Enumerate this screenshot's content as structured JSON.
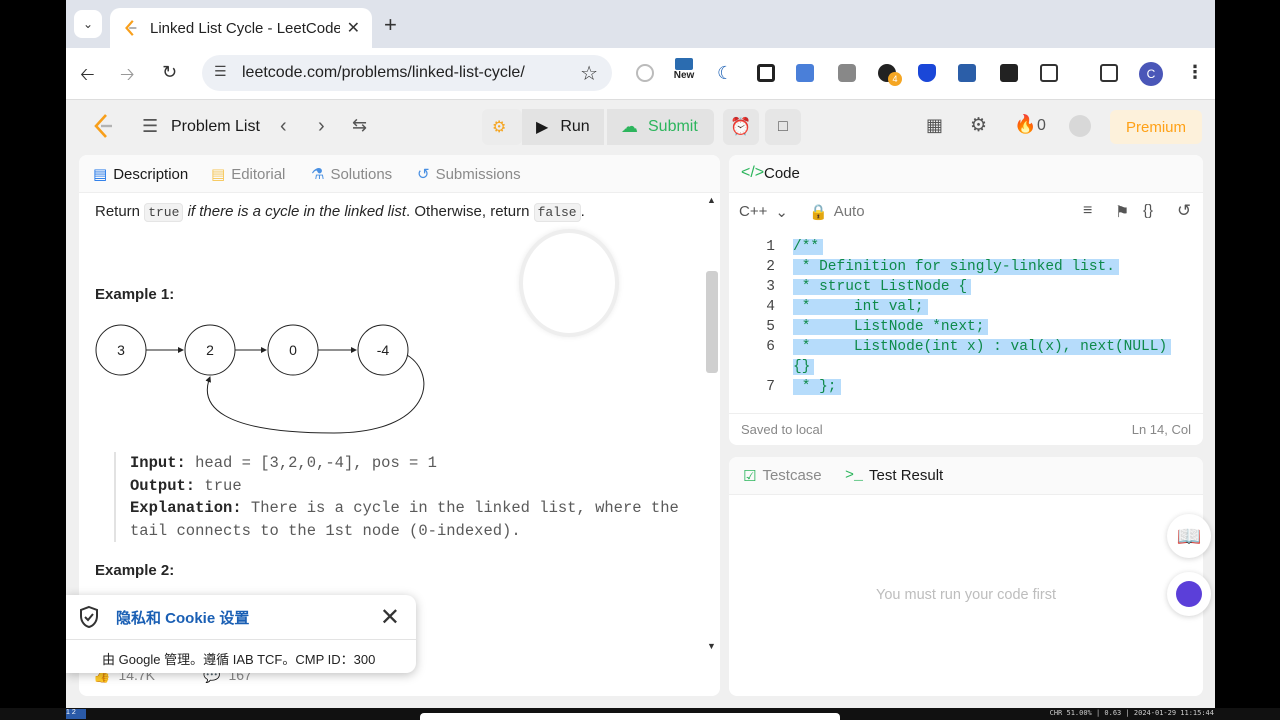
{
  "browser": {
    "tab_title": "Linked List Cycle - LeetCode",
    "url": "leetcode.com/problems/linked-list-cycle/",
    "ext_new_label": "New",
    "ext_badge": "4",
    "profile_initial": "C"
  },
  "nav": {
    "problem_list": "Problem List",
    "run": "Run",
    "submit": "Submit",
    "streak": "0",
    "premium": "Premium"
  },
  "left_tabs": [
    "Description",
    "Editorial",
    "Solutions",
    "Submissions"
  ],
  "description": {
    "return_prefix": "Return ",
    "true_code": "true",
    "italic": " if there is a cycle in the linked list",
    "otherwise": ". Otherwise, return ",
    "false_code": "false",
    "end": ".",
    "example1_title": "Example 1:",
    "example2_title": "Example 2:",
    "nodes": [
      "3",
      "2",
      "0",
      "-4"
    ],
    "input_label": "Input:",
    "input_value": " head = [3,2,0,-4], pos = 1",
    "output_label": "Output:",
    "output_value": " true",
    "explanation_label": "Explanation:",
    "explanation_line1": " There is a cycle in the linked list, where the",
    "explanation_line2": "tail connects to the 1st node (0-indexed).",
    "likes": "14.7K",
    "comments": "167"
  },
  "cookie": {
    "title": "隐私和 Cookie 设置",
    "subtitle": "由 Google 管理。遵循 IAB TCF。CMP ID：300"
  },
  "code": {
    "tab": "Code",
    "language": "C++",
    "mode": "Auto",
    "lines": [
      {
        "n": "1",
        "t": "/**"
      },
      {
        "n": "2",
        "t": " * Definition for singly-linked list."
      },
      {
        "n": "3",
        "t": " * struct ListNode {"
      },
      {
        "n": "4",
        "t": " *     int val;"
      },
      {
        "n": "5",
        "t": " *     ListNode *next;"
      },
      {
        "n": "6",
        "t": " *     ListNode(int x) : val(x), next(NULL)"
      },
      {
        "n": "",
        "t": "{}"
      },
      {
        "n": "7",
        "t": " * };"
      }
    ],
    "saved": "Saved to local",
    "cursor": "Ln 14, Col"
  },
  "test": {
    "testcase_tab": "Testcase",
    "result_tab": "Test Result",
    "empty_msg": "You must run your code first"
  },
  "taskbar": {
    "workspace": "1 2",
    "tray": "CHR 51.00% | 0.63 | 2024-01-29 11:15:44"
  }
}
